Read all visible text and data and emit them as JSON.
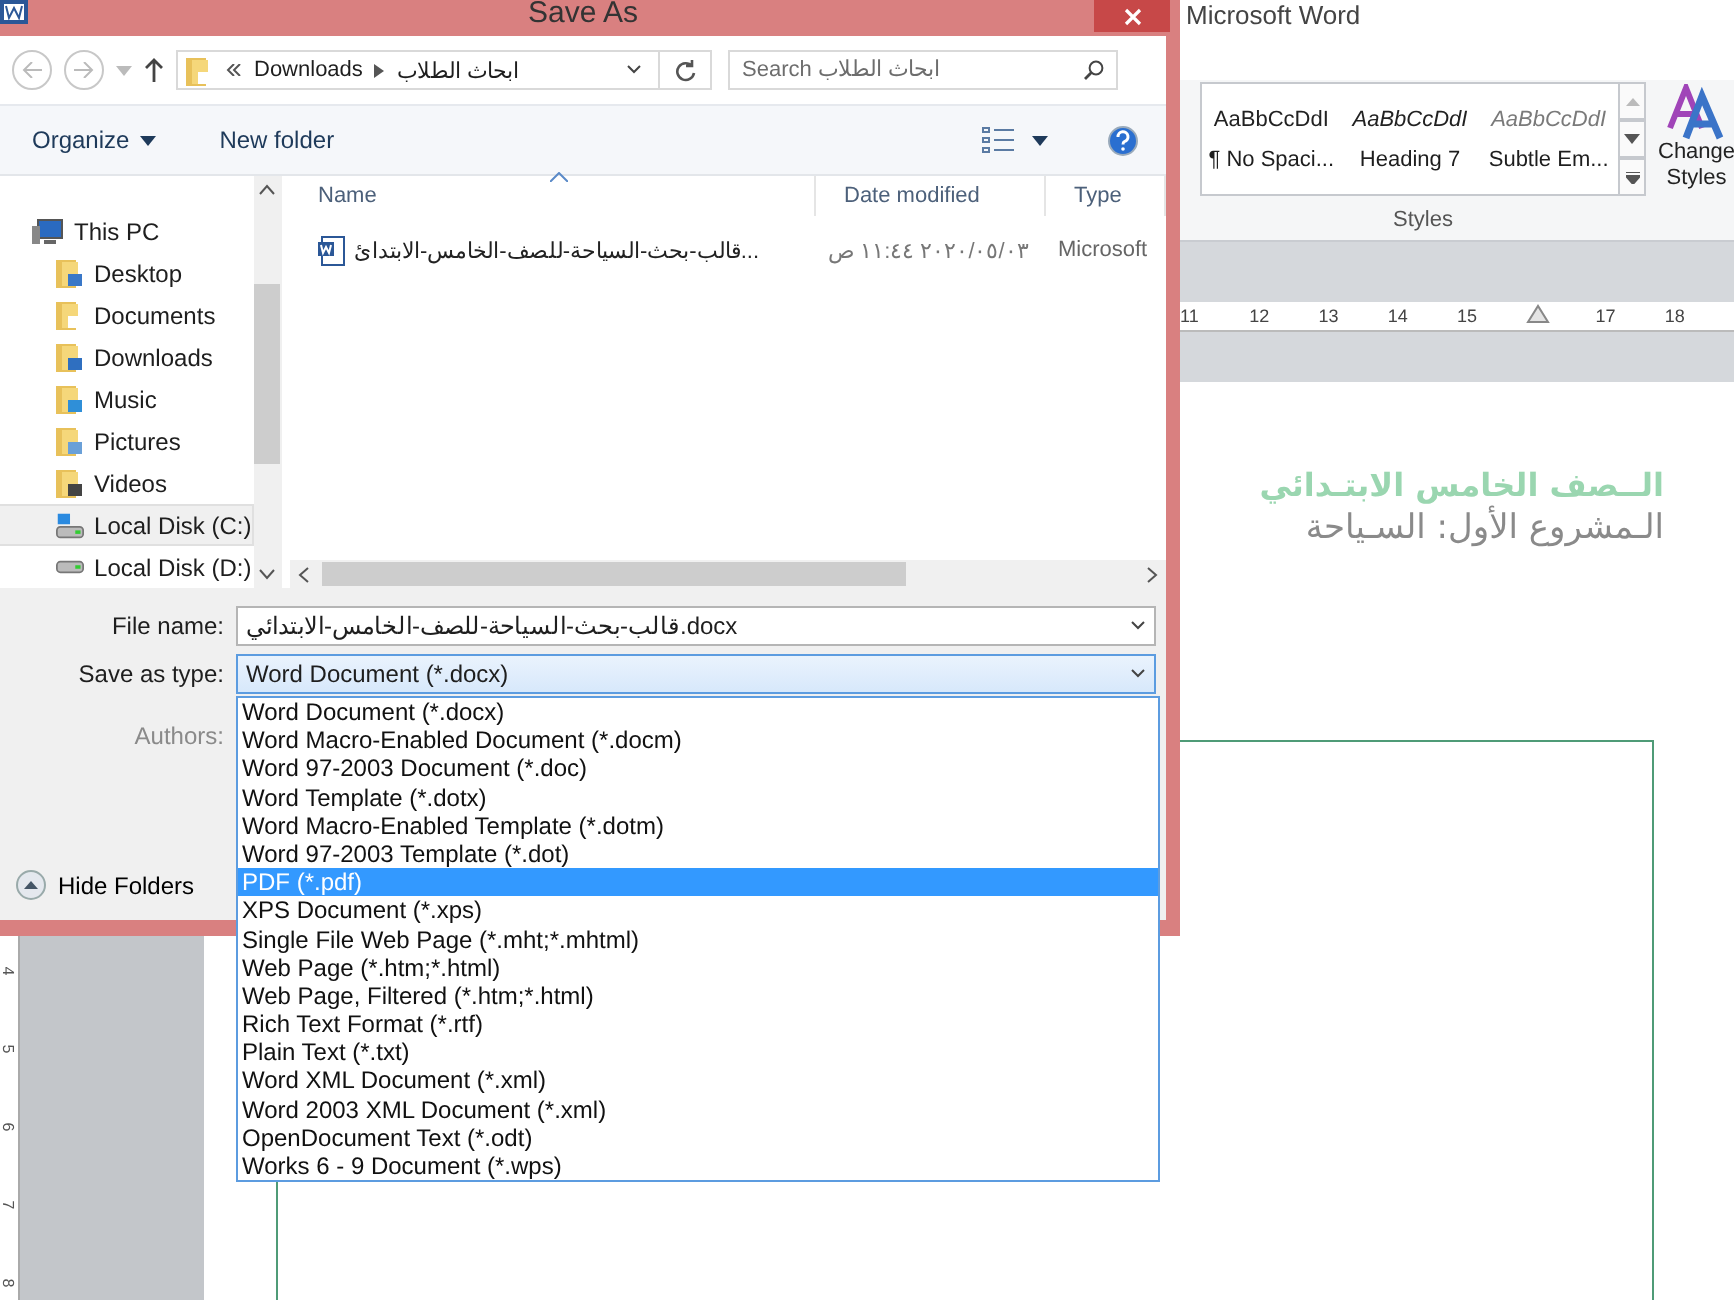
{
  "word": {
    "title": "Microsoft Word",
    "styles": [
      {
        "preview": "AaBbCcDdI",
        "name": "¶ No Spaci...",
        "kind": "normal"
      },
      {
        "preview": "AaBbCcDdI",
        "name": "Heading 7",
        "kind": "italic"
      },
      {
        "preview": "AaBbCcDdI",
        "name": "Subtle Em...",
        "kind": "subtle"
      }
    ],
    "change_styles": "Change Styles",
    "group_label": "Styles",
    "ruler": [
      {
        "kind": "number",
        "label": "11"
      },
      {
        "kind": "number",
        "label": "12"
      },
      {
        "kind": "number",
        "label": "13"
      },
      {
        "kind": "number",
        "label": "14"
      },
      {
        "kind": "number",
        "label": "15"
      },
      {
        "kind": "marker"
      },
      {
        "kind": "number",
        "label": "17"
      },
      {
        "kind": "number",
        "label": "18"
      }
    ],
    "vertical_ruler": [
      "4",
      "5",
      "6",
      "7",
      "8"
    ],
    "document": [
      {
        "kind": "heading",
        "text": "الــصف الخامس الابتـدائي"
      },
      {
        "kind": "subheading",
        "text": "الـمشروع الأول: السـياحة"
      }
    ]
  },
  "dialog": {
    "title": "Save As",
    "path": [
      "Downloads",
      "ابحاث الطلاب"
    ],
    "search": {
      "placeholder": "Search ابحاث الطلاب"
    },
    "toolbar": [
      {
        "kind": "menu",
        "label": "Organize"
      },
      {
        "kind": "button",
        "label": "New folder"
      }
    ],
    "navigation": [
      {
        "label": "This PC",
        "kind": "computer",
        "selected": false,
        "children": [
          {
            "label": "Desktop",
            "kind": "desktop",
            "selected": false
          },
          {
            "label": "Documents",
            "kind": "documents",
            "selected": false
          },
          {
            "label": "Downloads",
            "kind": "downloads",
            "selected": false
          },
          {
            "label": "Music",
            "kind": "music",
            "selected": false
          },
          {
            "label": "Pictures",
            "kind": "pictures",
            "selected": false
          },
          {
            "label": "Videos",
            "kind": "videos",
            "selected": false
          },
          {
            "label": "Local Disk (C:)",
            "kind": "system_disk",
            "selected": true
          },
          {
            "label": "Local Disk (D:)",
            "kind": "disk",
            "selected": false
          }
        ]
      }
    ],
    "columns": [
      "Name",
      "Date modified",
      "Type"
    ],
    "files": [
      {
        "name": "قالب-بحث-السياحة-للصف-الخامس-الابتدائ...",
        "date": "٢٠٢٠/٠٥/٠٣ ١١:٤٤ ص",
        "type": "Microsoft"
      }
    ],
    "form": {
      "file_name_label": "File name:",
      "file_name": "قالب-بحث-السياحة-للصف-الخامس-الابتدائي.docx",
      "type_label": "Save as type:",
      "save_as_type": "Word Document (*.docx)",
      "authors_label": "Authors:"
    },
    "hide_folders": "Hide Folders",
    "type_options": [
      {
        "label": "Word Document (*.docx)",
        "selected": false
      },
      {
        "label": "Word Macro-Enabled Document (*.docm)",
        "selected": false
      },
      {
        "label": "Word 97-2003 Document (*.doc)",
        "selected": false
      },
      {
        "label": "Word Template (*.dotx)",
        "selected": false
      },
      {
        "label": "Word Macro-Enabled Template (*.dotm)",
        "selected": false
      },
      {
        "label": "Word 97-2003 Template (*.dot)",
        "selected": false
      },
      {
        "label": "PDF (*.pdf)",
        "selected": true
      },
      {
        "label": "XPS Document (*.xps)",
        "selected": false
      },
      {
        "label": "Single File Web Page (*.mht;*.mhtml)",
        "selected": false
      },
      {
        "label": "Web Page (*.htm;*.html)",
        "selected": false
      },
      {
        "label": "Web Page, Filtered (*.htm;*.html)",
        "selected": false
      },
      {
        "label": "Rich Text Format (*.rtf)",
        "selected": false
      },
      {
        "label": "Plain Text (*.txt)",
        "selected": false
      },
      {
        "label": "Word XML Document (*.xml)",
        "selected": false
      },
      {
        "label": "Word 2003 XML Document (*.xml)",
        "selected": false
      },
      {
        "label": "OpenDocument Text (*.odt)",
        "selected": false
      },
      {
        "label": "Works 6 - 9 Document (*.wps)",
        "selected": false
      }
    ]
  }
}
